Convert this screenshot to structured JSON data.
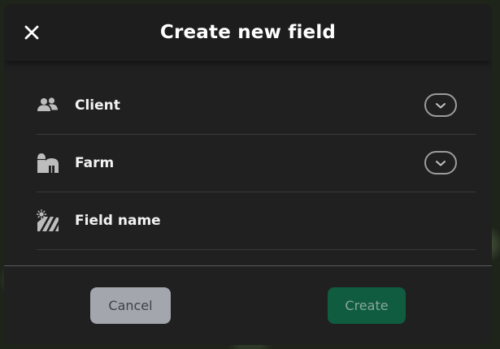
{
  "dialog": {
    "title": "Create new field",
    "close_icon": "close-icon"
  },
  "fields": [
    {
      "label": "Client",
      "icon": "client-users-icon",
      "has_dropdown": true
    },
    {
      "label": "Farm",
      "icon": "farm-barn-icon",
      "has_dropdown": true
    },
    {
      "label": "Field name",
      "icon": "field-sun-icon",
      "has_dropdown": false
    }
  ],
  "actions": {
    "cancel_label": "Cancel",
    "create_label": "Create"
  },
  "colors": {
    "dialog_bg": "#202020",
    "header_bg": "#1d1d1d",
    "cancel_bg": "#a3a6ad",
    "create_bg": "#0f5c40",
    "create_text_disabled": "#8aa89a"
  }
}
